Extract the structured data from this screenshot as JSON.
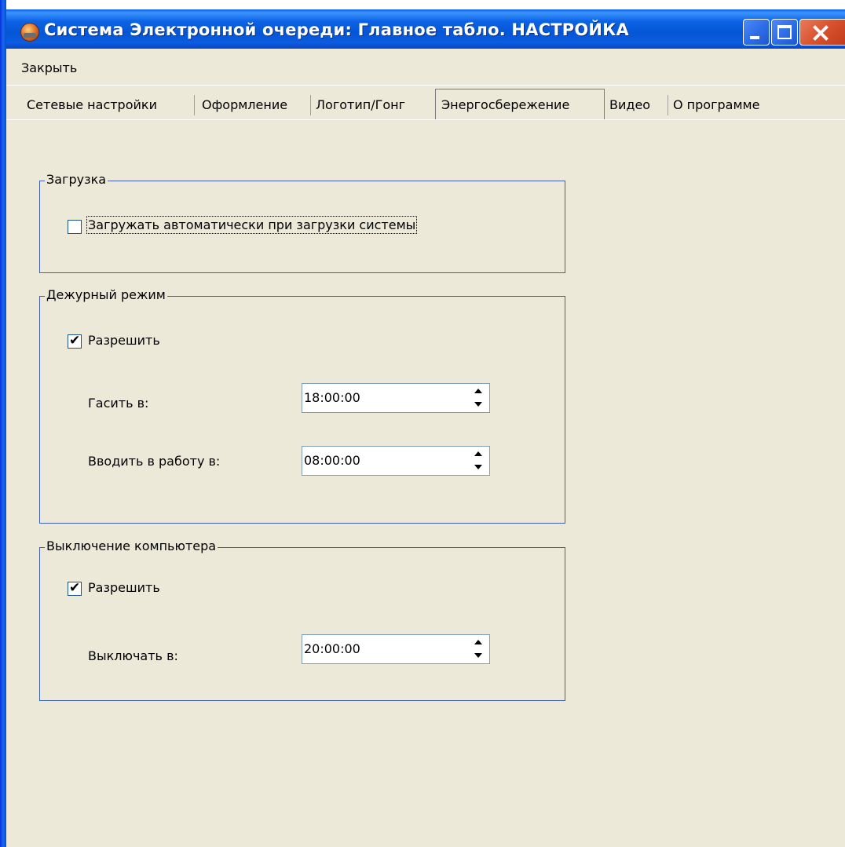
{
  "window": {
    "title": "Система  Электронной очереди: Главное табло. НАСТРОЙКА",
    "icon": "app-helmet-icon"
  },
  "menu": {
    "items": [
      "Закрыть"
    ]
  },
  "tabs": [
    {
      "label": "Сетевые настройки",
      "active": false
    },
    {
      "label": "Оформление",
      "active": false
    },
    {
      "label": "Логотип/Гонг",
      "active": false
    },
    {
      "label": "Энергосбережение",
      "active": true
    },
    {
      "label": "Видео",
      "active": false
    },
    {
      "label": "О программе",
      "active": false
    }
  ],
  "groups": {
    "load": {
      "legend": "Загрузка",
      "autoload": {
        "label": "Загружать автоматически при загрузки системы",
        "checked": false
      }
    },
    "standby": {
      "legend": "Дежурный режим",
      "enable": {
        "label": "Разрешить",
        "checked": true
      },
      "off_label": "Гасить в:",
      "off_time": "18:00:00",
      "on_label": "Вводить в работу в:",
      "on_time": "08:00:00"
    },
    "shutdown": {
      "legend": "Выключение компьютера",
      "enable": {
        "label": "Разрешить",
        "checked": true
      },
      "time_label": "Выключать в:",
      "time": "20:00:00"
    }
  },
  "checkmark": "✔"
}
